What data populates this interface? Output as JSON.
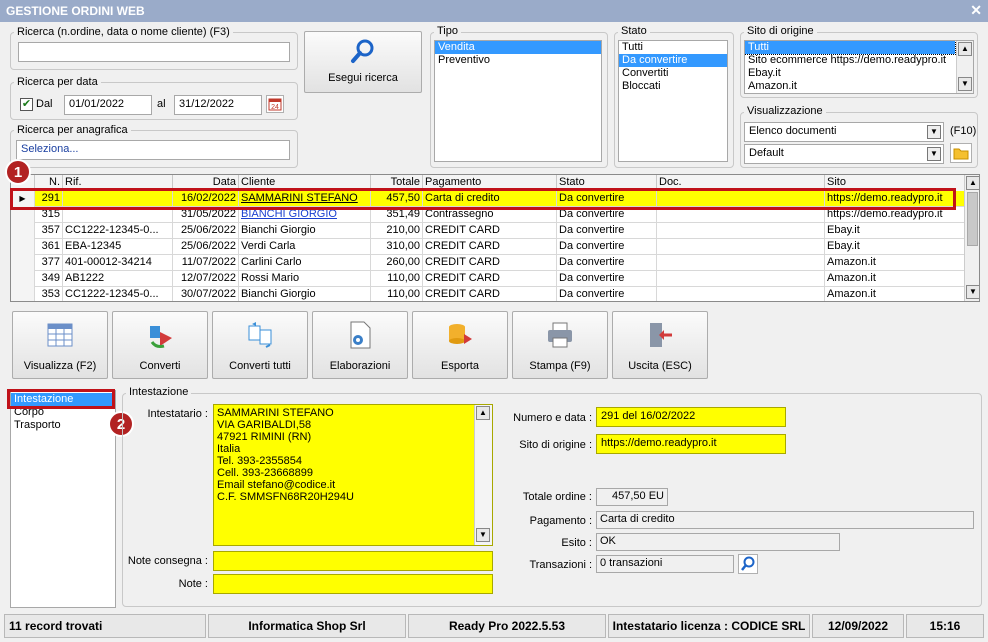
{
  "window": {
    "title": "GESTIONE ORDINI WEB"
  },
  "search": {
    "group_label": "Ricerca (n.ordine, data o nome cliente) (F3)",
    "value": "",
    "button_label": "Esegui ricerca"
  },
  "date_search": {
    "group_label": "Ricerca per data",
    "dal_label": "Dal",
    "dal_checked": true,
    "from": "01/01/2022",
    "al_label": "al",
    "to": "31/12/2022"
  },
  "registry_search": {
    "group_label": "Ricerca per anagrafica",
    "value": "Seleziona..."
  },
  "tipo": {
    "label": "Tipo",
    "items": [
      "Vendita",
      "Preventivo"
    ],
    "selected": 0
  },
  "stato": {
    "label": "Stato",
    "items": [
      "Tutti",
      "Da convertire",
      "Convertiti",
      "Bloccati"
    ],
    "selected": 1
  },
  "sito": {
    "label": "Sito di origine",
    "items": [
      "Tutti",
      "Sito ecommerce https://demo.readypro.it",
      "Ebay.it",
      "Amazon.it"
    ],
    "selected": 0
  },
  "visualizzazione": {
    "label": "Visualizzazione",
    "view": "Elenco documenti",
    "shortcut": "(F10)",
    "layout": "Default"
  },
  "grid": {
    "columns": [
      "N.",
      "Rif.",
      "Data",
      "Cliente",
      "Totale",
      "Pagamento",
      "Stato",
      "Doc.",
      "Sito"
    ],
    "rows": [
      [
        "291",
        "",
        "16/02/2022",
        "SAMMARINI STEFANO",
        "457,50",
        "Carta di credito",
        "Da convertire",
        "",
        "https://demo.readypro.it"
      ],
      [
        "315",
        "",
        "31/05/2022",
        "BIANCHI GIORGIO",
        "351,49",
        "Contrassegno",
        "Da convertire",
        "",
        "https://demo.readypro.it"
      ],
      [
        "357",
        "CC1222-12345-0...",
        "25/06/2022",
        "Bianchi Giorgio",
        "210,00",
        "CREDIT CARD",
        "Da convertire",
        "",
        "Ebay.it"
      ],
      [
        "361",
        "EBA-12345",
        "25/06/2022",
        "Verdi Carla",
        "310,00",
        "CREDIT CARD",
        "Da convertire",
        "",
        "Ebay.it"
      ],
      [
        "377",
        "401-00012-34214",
        "11/07/2022",
        "Carlini Carlo",
        "260,00",
        "CREDIT CARD",
        "Da convertire",
        "",
        "Amazon.it"
      ],
      [
        "349",
        "AB1222",
        "12/07/2022",
        "Rossi Mario",
        "110,00",
        "CREDIT CARD",
        "Da convertire",
        "",
        "Amazon.it"
      ],
      [
        "353",
        "CC1222-12345-0...",
        "30/07/2022",
        "Bianchi Giorgio",
        "110,00",
        "CREDIT CARD",
        "Da convertire",
        "",
        "Amazon.it"
      ]
    ]
  },
  "toolbar": {
    "visualizza": "Visualizza (F2)",
    "converti": "Converti",
    "converti_tutti": "Converti tutti",
    "elaborazioni": "Elaborazioni",
    "esporta": "Esporta",
    "stampa": "Stampa (F9)",
    "uscita": "Uscita (ESC)"
  },
  "sections": {
    "items": [
      "Intestazione",
      "Corpo",
      "Trasporto"
    ],
    "selected": 0
  },
  "badges": {
    "one": "1",
    "two": "2"
  },
  "detail": {
    "group_label": "Intestazione",
    "intestatario_label": "Intestatario :",
    "intestatario_lines": [
      "SAMMARINI STEFANO",
      "VIA GARIBALDI,58",
      "47921 RIMINI (RN)",
      "Italia",
      "Tel. 393-2355854",
      "Cell. 393-23668899",
      "Email stefano@codice.it",
      "C.F. SMMSFN68R20H294U"
    ],
    "note_consegna_label": "Note consegna :",
    "note_consegna": "",
    "note_label": "Note :",
    "note": "",
    "numero_label": "Numero e data :",
    "numero": "291 del 16/02/2022",
    "sito_label": "Sito di origine :",
    "sito": "https://demo.readypro.it",
    "totale_label": "Totale ordine :",
    "totale": "457,50 EU",
    "pagamento_label": "Pagamento :",
    "pagamento": "Carta di credito",
    "esito_label": "Esito :",
    "esito": "OK",
    "transazioni_label": "Transazioni :",
    "transazioni": "0 transazioni"
  },
  "statusbar": {
    "records": "11 record trovati",
    "company": "Informatica Shop Srl",
    "version": "Ready Pro 2022.5.53",
    "license": "Intestatario licenza : CODICE SRL",
    "date": "12/09/2022",
    "time": "15:16"
  },
  "colors": {
    "title_bar": "#9aabc9",
    "highlight": "#ffff00",
    "selection": "#3399ff",
    "callout": "#b22222"
  }
}
